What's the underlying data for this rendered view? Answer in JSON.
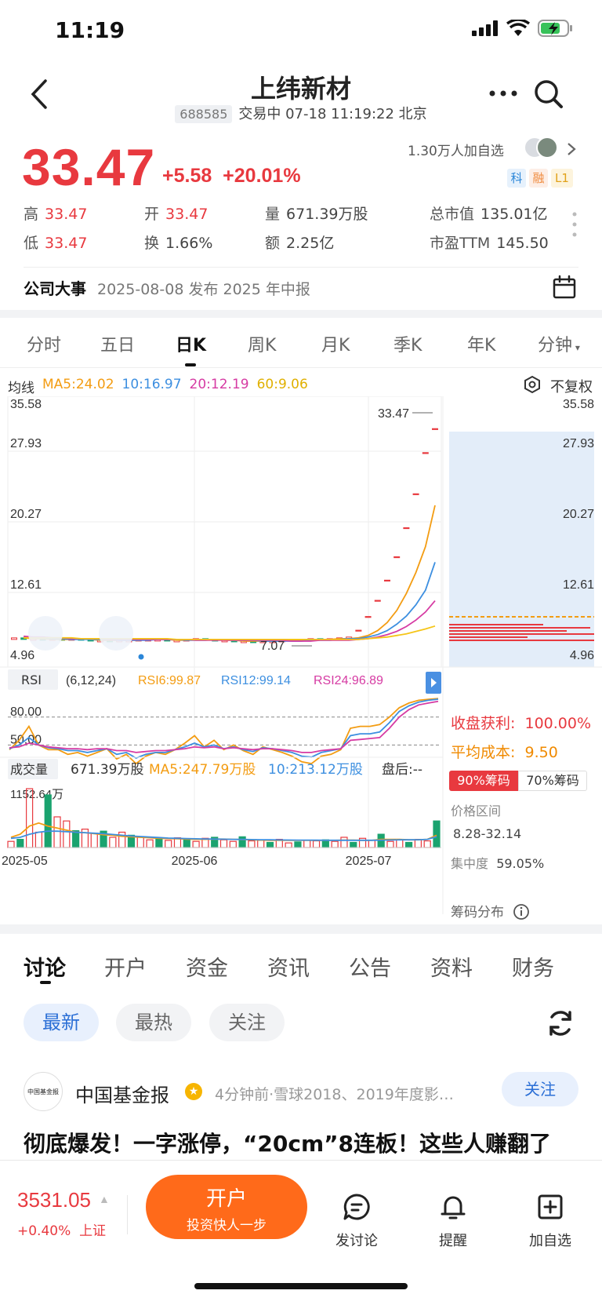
{
  "status": {
    "time": "11:19"
  },
  "header": {
    "title": "上纬新材",
    "code": "688585",
    "status_text": "交易中 07-18 11:19:22 北京"
  },
  "quote": {
    "price": "33.47",
    "change": "+5.58",
    "change_pct": "+20.01%",
    "followers": "1.30万人加自选",
    "tags": [
      "科",
      "融",
      "L1"
    ]
  },
  "stats": {
    "high_label": "高",
    "high": "33.47",
    "low_label": "低",
    "low": "33.47",
    "open_label": "开",
    "open": "33.47",
    "turnover_label": "换",
    "turnover": "1.66%",
    "volume_label": "量",
    "volume": "671.39万股",
    "amount_label": "额",
    "amount": "2.25亿",
    "mktcap_label": "总市值",
    "mktcap": "135.01亿",
    "pe_label": "市盈TTM",
    "pe": "145.50"
  },
  "event": {
    "label": "公司大事",
    "text": "2025-08-08 发布 2025 年中报"
  },
  "ktabs": [
    "分时",
    "五日",
    "日K",
    "周K",
    "月K",
    "季K",
    "年K",
    "分钟"
  ],
  "ktab_active": "日K",
  "ma": {
    "label": "均线",
    "ma5": "MA5:24.02",
    "ma10": "10:16.97",
    "ma20": "20:12.19",
    "ma60": "60:9.06",
    "adjust": "不复权"
  },
  "colors": {
    "up": "#e8393f",
    "down": "#1aa36f",
    "ma5": "#f39c12",
    "ma10": "#3d8fe0",
    "ma20": "#d63ba3",
    "ma60": "#f5c518",
    "accent": "#ff6a1a"
  },
  "chart_data": [
    {
      "type": "candlestick",
      "title": "",
      "y_ticks": [
        "35.58",
        "27.93",
        "20.27",
        "12.61",
        "4.96"
      ],
      "ylim": [
        4.96,
        35.58
      ],
      "max_label": "33.47",
      "min_label": "7.07",
      "x_ticks": [
        "2025-05",
        "2025-06",
        "2025-07"
      ],
      "series": [
        {
          "name": "MA5",
          "values": [
            7.6,
            7.5,
            7.5,
            7.4,
            7.4,
            7.4,
            7.5,
            7.4,
            7.3,
            7.3,
            7.3,
            7.3,
            7.3,
            7.4,
            7.4,
            7.4,
            7.3,
            7.3,
            7.4,
            7.4,
            7.4,
            7.3,
            7.3,
            7.2,
            7.2,
            7.2,
            7.2,
            7.2,
            7.3,
            7.3,
            7.4,
            7.4,
            7.4,
            7.5,
            7.5,
            7.6,
            7.9,
            8.5,
            9.5,
            11.0,
            13.1,
            15.7,
            18.9,
            24.02
          ]
        },
        {
          "name": "MA10",
          "values": [
            7.7,
            7.6,
            7.6,
            7.5,
            7.5,
            7.4,
            7.4,
            7.4,
            7.4,
            7.4,
            7.3,
            7.3,
            7.3,
            7.3,
            7.4,
            7.4,
            7.4,
            7.3,
            7.3,
            7.3,
            7.4,
            7.4,
            7.3,
            7.3,
            7.3,
            7.2,
            7.2,
            7.2,
            7.2,
            7.2,
            7.3,
            7.3,
            7.3,
            7.4,
            7.5,
            7.5,
            7.7,
            8.0,
            8.5,
            9.3,
            10.3,
            11.7,
            13.5,
            16.97
          ]
        },
        {
          "name": "MA20",
          "values": [
            7.8,
            7.7,
            7.7,
            7.6,
            7.6,
            7.5,
            7.5,
            7.5,
            7.5,
            7.4,
            7.4,
            7.4,
            7.4,
            7.4,
            7.4,
            7.4,
            7.4,
            7.4,
            7.3,
            7.3,
            7.3,
            7.3,
            7.3,
            7.3,
            7.3,
            7.3,
            7.3,
            7.3,
            7.2,
            7.2,
            7.2,
            7.3,
            7.3,
            7.3,
            7.3,
            7.4,
            7.5,
            7.7,
            8.0,
            8.4,
            9.0,
            9.8,
            10.8,
            12.19
          ]
        },
        {
          "name": "60",
          "values": [
            7.6,
            7.6,
            7.6,
            7.6,
            7.6,
            7.6,
            7.5,
            7.5,
            7.5,
            7.5,
            7.5,
            7.5,
            7.5,
            7.5,
            7.5,
            7.5,
            7.4,
            7.4,
            7.4,
            7.4,
            7.4,
            7.4,
            7.4,
            7.4,
            7.4,
            7.4,
            7.4,
            7.4,
            7.4,
            7.4,
            7.4,
            7.4,
            7.4,
            7.4,
            7.4,
            7.4,
            7.5,
            7.6,
            7.7,
            7.9,
            8.1,
            8.4,
            8.7,
            9.06
          ]
        },
        {
          "name": "close",
          "values": [
            7.6,
            7.5,
            7.5,
            7.4,
            7.5,
            7.4,
            7.5,
            7.4,
            7.3,
            7.3,
            7.2,
            7.3,
            7.3,
            7.4,
            7.4,
            7.4,
            7.3,
            7.3,
            7.4,
            7.5,
            7.4,
            7.3,
            7.3,
            7.2,
            7.2,
            7.1,
            7.2,
            7.2,
            7.3,
            7.4,
            7.4,
            7.5,
            7.4,
            7.5,
            7.6,
            7.7,
            8.5,
            10.2,
            12.2,
            14.7,
            17.6,
            21.2,
            25.4,
            30.5,
            33.47
          ]
        }
      ]
    },
    {
      "type": "line",
      "title": "RSI",
      "params": "(6,12,24)",
      "legend": [
        "RSI6:99.87",
        "RSI12:99.14",
        "RSI24:96.89"
      ],
      "y_ticks": [
        "80.00",
        "50.00"
      ],
      "ylim": [
        20,
        100
      ],
      "series": [
        {
          "name": "RSI6",
          "values": [
            45,
            55,
            70,
            50,
            45,
            45,
            40,
            42,
            38,
            42,
            46,
            35,
            40,
            30,
            38,
            42,
            40,
            45,
            52,
            60,
            48,
            55,
            45,
            50,
            44,
            40,
            48,
            45,
            42,
            38,
            32,
            30,
            38,
            40,
            45,
            68,
            70,
            70,
            72,
            80,
            90,
            95,
            98,
            99,
            99.87
          ]
        },
        {
          "name": "RSI12",
          "values": [
            46,
            50,
            58,
            50,
            47,
            46,
            44,
            44,
            42,
            44,
            46,
            40,
            42,
            36,
            40,
            42,
            42,
            45,
            48,
            52,
            48,
            50,
            46,
            48,
            45,
            43,
            47,
            46,
            44,
            42,
            38,
            37,
            42,
            44,
            46,
            60,
            62,
            62,
            64,
            74,
            86,
            92,
            96,
            98,
            99.14
          ]
        },
        {
          "name": "RSI24",
          "values": [
            47,
            48,
            52,
            50,
            48,
            47,
            46,
            46,
            45,
            46,
            46,
            44,
            44,
            42,
            43,
            44,
            44,
            45,
            46,
            48,
            47,
            48,
            46,
            47,
            46,
            45,
            46,
            46,
            45,
            44,
            42,
            42,
            44,
            45,
            46,
            55,
            56,
            57,
            58,
            68,
            80,
            88,
            93,
            95,
            96.89
          ]
        }
      ]
    },
    {
      "type": "bar",
      "title": "成交量",
      "legend": [
        "671.39万股",
        "MA5:247.79万股",
        "10:213.12万股",
        "盘后:--"
      ],
      "y_max_label": "1152.64万",
      "ylim": [
        0,
        1152.64
      ],
      "values": [
        120,
        160,
        1152,
        300,
        1030,
        600,
        520,
        330,
        360,
        280,
        320,
        200,
        300,
        240,
        200,
        150,
        180,
        140,
        190,
        160,
        120,
        180,
        200,
        150,
        120,
        210,
        130,
        140,
        100,
        160,
        90,
        110,
        140,
        130,
        150,
        120,
        200,
        100,
        180,
        140,
        260,
        120,
        150,
        100,
        160,
        130,
        520
      ]
    }
  ],
  "chip": {
    "profit_label": "收盘获利:",
    "profit": "100.00%",
    "cost_label": "平均成本:",
    "cost": "9.50",
    "tab90": "90%筹码",
    "tab70": "70%筹码",
    "range_label": "价格区间",
    "range": "8.28-32.14",
    "conc_label": "集中度",
    "conc": "59.05%",
    "dist_label": "筹码分布",
    "y_ticks": [
      "35.58",
      "27.93",
      "20.27",
      "12.61",
      "4.96"
    ]
  },
  "discuss": {
    "tabs": [
      "讨论",
      "开户",
      "资金",
      "资讯",
      "公告",
      "资料",
      "财务"
    ],
    "active": "讨论",
    "filters": [
      "最新",
      "最热",
      "关注"
    ],
    "active_filter": "最新"
  },
  "post": {
    "author": "中国基金报",
    "logo_text": "中国基金报",
    "meta": "4分钟前·雪球2018、2019年度影…",
    "follow": "关注",
    "title": "彻底爆发！一字涨停，“20cm”8连板！这些人赚翻了"
  },
  "bottom": {
    "index_value": "3531.05",
    "index_change": "+0.40%",
    "index_name": "上证",
    "open_account": "开户",
    "open_sub": "投资快人一步",
    "post_label": "发讨论",
    "remind_label": "提醒",
    "add_label": "加自选"
  }
}
